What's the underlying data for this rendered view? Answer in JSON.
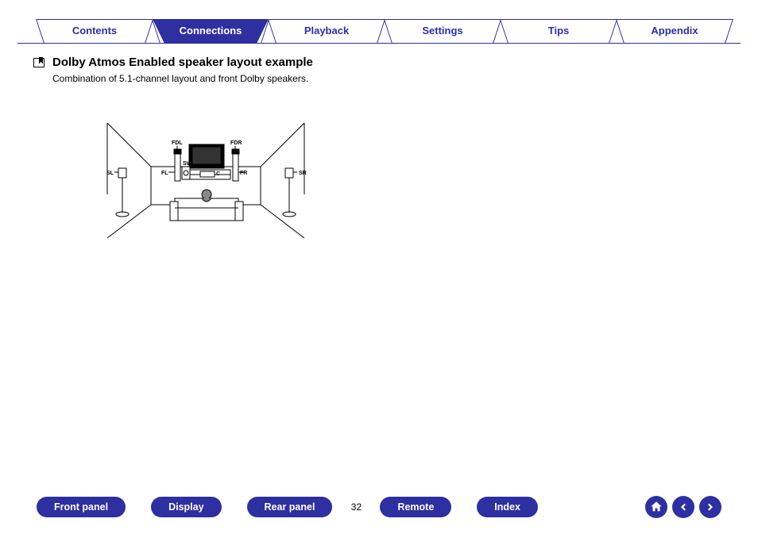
{
  "tabs": [
    {
      "label": "Contents",
      "active": false
    },
    {
      "label": "Connections",
      "active": true
    },
    {
      "label": "Playback",
      "active": false
    },
    {
      "label": "Settings",
      "active": false
    },
    {
      "label": "Tips",
      "active": false
    },
    {
      "label": "Appendix",
      "active": false
    }
  ],
  "heading": {
    "title": "Dolby Atmos Enabled speaker layout example",
    "subtitle": "Combination of 5.1-channel layout and front Dolby speakers."
  },
  "diagram": {
    "labels": {
      "sl": "SL",
      "sr": "SR",
      "fl": "FL",
      "fr": "FR",
      "fdl": "FDL",
      "fdr": "FDR",
      "sw": "SW",
      "c": "C"
    }
  },
  "bottom_nav": [
    {
      "label": "Front panel"
    },
    {
      "label": "Display"
    },
    {
      "label": "Rear panel"
    }
  ],
  "bottom_nav2": [
    {
      "label": "Remote"
    },
    {
      "label": "Index"
    }
  ],
  "page_number": "32",
  "icons": {
    "home": "home-icon",
    "back": "arrow-left-icon",
    "forward": "arrow-right-icon"
  }
}
